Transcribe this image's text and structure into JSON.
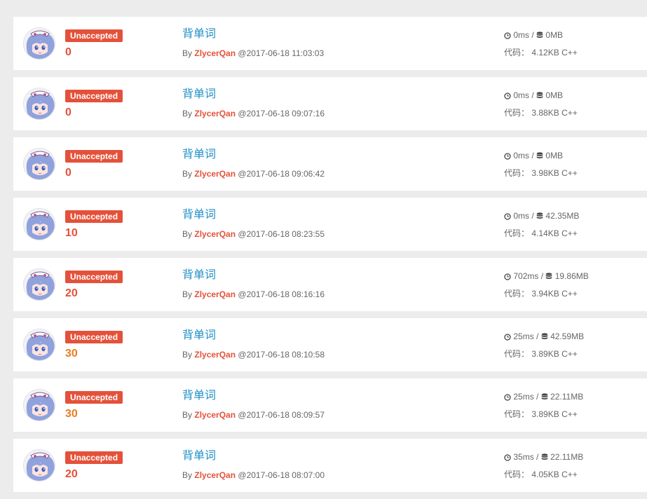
{
  "colors": {
    "badge": "#e4513a",
    "title_link": "#1e8fc6",
    "author": "#e4513a",
    "score_red": "#e4513a",
    "score_orange": "#e67e22",
    "text_gray": "#666666",
    "page_bg": "#ececec"
  },
  "icons": {
    "time": "clock-icon",
    "memory": "database-icon"
  },
  "submissions": [
    {
      "status": "Unaccepted",
      "score": "0",
      "score_color": "#e4513a",
      "title": "背单词",
      "by": "By",
      "author": "ZlycerQan",
      "time": "@2017-06-18 11:03:03",
      "runtime": "0ms",
      "sep": "/",
      "memory": "0MB",
      "code_label": "代码：",
      "code_size": "4.12KB",
      "lang": "C++"
    },
    {
      "status": "Unaccepted",
      "score": "0",
      "score_color": "#e4513a",
      "title": "背单词",
      "by": "By",
      "author": "ZlycerQan",
      "time": "@2017-06-18 09:07:16",
      "runtime": "0ms",
      "sep": "/",
      "memory": "0MB",
      "code_label": "代码：",
      "code_size": "3.88KB",
      "lang": "C++"
    },
    {
      "status": "Unaccepted",
      "score": "0",
      "score_color": "#e4513a",
      "title": "背单词",
      "by": "By",
      "author": "ZlycerQan",
      "time": "@2017-06-18 09:06:42",
      "runtime": "0ms",
      "sep": "/",
      "memory": "0MB",
      "code_label": "代码：",
      "code_size": "3.98KB",
      "lang": "C++"
    },
    {
      "status": "Unaccepted",
      "score": "10",
      "score_color": "#e4513a",
      "title": "背单词",
      "by": "By",
      "author": "ZlycerQan",
      "time": "@2017-06-18 08:23:55",
      "runtime": "0ms",
      "sep": "/",
      "memory": "42.35MB",
      "code_label": "代码：",
      "code_size": "4.14KB",
      "lang": "C++"
    },
    {
      "status": "Unaccepted",
      "score": "20",
      "score_color": "#e4513a",
      "title": "背单词",
      "by": "By",
      "author": "ZlycerQan",
      "time": "@2017-06-18 08:16:16",
      "runtime": "702ms",
      "sep": "/",
      "memory": "19.86MB",
      "code_label": "代码：",
      "code_size": "3.94KB",
      "lang": "C++"
    },
    {
      "status": "Unaccepted",
      "score": "30",
      "score_color": "#e67e22",
      "title": "背单词",
      "by": "By",
      "author": "ZlycerQan",
      "time": "@2017-06-18 08:10:58",
      "runtime": "25ms",
      "sep": "/",
      "memory": "42.59MB",
      "code_label": "代码：",
      "code_size": "3.89KB",
      "lang": "C++"
    },
    {
      "status": "Unaccepted",
      "score": "30",
      "score_color": "#e67e22",
      "title": "背单词",
      "by": "By",
      "author": "ZlycerQan",
      "time": "@2017-06-18 08:09:57",
      "runtime": "25ms",
      "sep": "/",
      "memory": "22.11MB",
      "code_label": "代码：",
      "code_size": "3.89KB",
      "lang": "C++"
    },
    {
      "status": "Unaccepted",
      "score": "20",
      "score_color": "#e4513a",
      "title": "背单词",
      "by": "By",
      "author": "ZlycerQan",
      "time": "@2017-06-18 08:07:00",
      "runtime": "35ms",
      "sep": "/",
      "memory": "22.11MB",
      "code_label": "代码：",
      "code_size": "4.05KB",
      "lang": "C++"
    }
  ]
}
